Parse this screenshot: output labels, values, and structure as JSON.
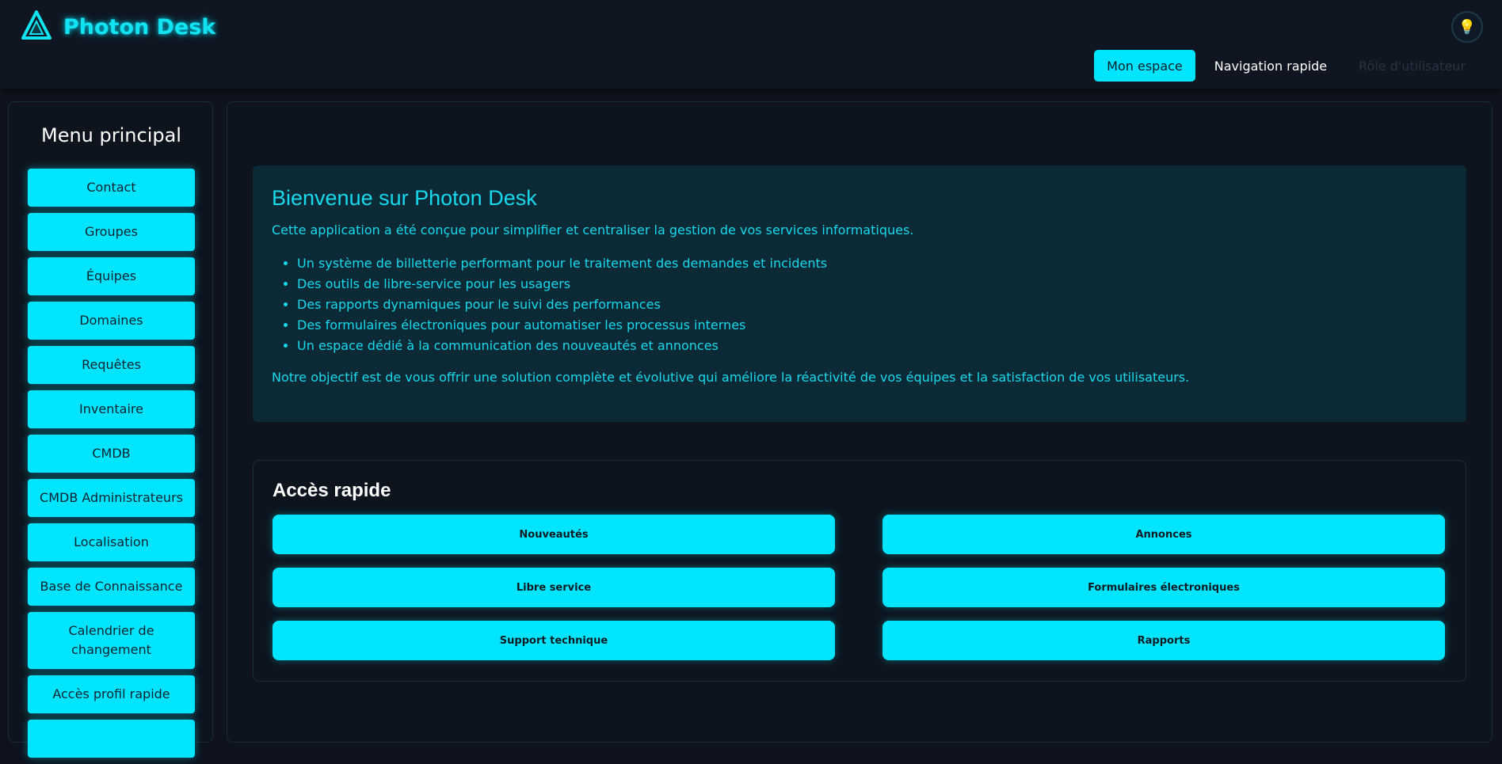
{
  "app": {
    "title": "Photon Desk",
    "logo_icon": "triangle-logo-icon",
    "theme_icon": "lightbulb-icon"
  },
  "topnav": {
    "items": [
      {
        "label": "Mon espace",
        "state": "active"
      },
      {
        "label": "Navigation rapide",
        "state": "normal"
      },
      {
        "label": "Rôle d'utilisateur",
        "state": "disabled"
      }
    ]
  },
  "sidebar": {
    "title": "Menu principal",
    "items": [
      {
        "label": "Contact"
      },
      {
        "label": "Groupes"
      },
      {
        "label": "Équipes"
      },
      {
        "label": "Domaines"
      },
      {
        "label": "Requêtes"
      },
      {
        "label": "Inventaire"
      },
      {
        "label": "CMDB"
      },
      {
        "label": "CMDB Administrateurs"
      },
      {
        "label": "Localisation"
      },
      {
        "label": "Base de Connaissance"
      },
      {
        "label": "Calendrier de changement"
      },
      {
        "label": "Accès profil rapide"
      },
      {
        "label": ""
      }
    ]
  },
  "welcome": {
    "title": "Bienvenue sur Photon Desk",
    "intro": "Cette application a été conçue pour simplifier et centraliser la gestion de vos services informatiques.",
    "features": [
      "Un système de billetterie performant pour le traitement des demandes et incidents",
      "Des outils de libre-service pour les usagers",
      "Des rapports dynamiques pour le suivi des performances",
      "Des formulaires électroniques pour automatiser les processus internes",
      "Un espace dédié à la communication des nouveautés et annonces"
    ],
    "closing": "Notre objectif est de vous offrir une solution complète et évolutive qui améliore la réactivité de vos équipes et la satisfaction de vos utilisateurs."
  },
  "quick_access": {
    "title": "Accès rapide",
    "buttons": [
      {
        "label": "Nouveautés"
      },
      {
        "label": "Annonces"
      },
      {
        "label": "Libre service"
      },
      {
        "label": "Formulaires électroniques"
      },
      {
        "label": "Support technique"
      },
      {
        "label": "Rapports"
      }
    ]
  },
  "colors": {
    "accent": "#00e5ff",
    "background": "#0d121d",
    "panel": "#0c2a35"
  }
}
